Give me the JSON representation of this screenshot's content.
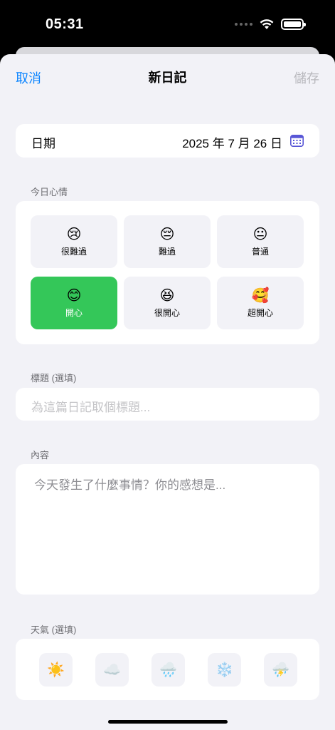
{
  "status_bar": {
    "time": "05:31"
  },
  "nav": {
    "cancel": "取消",
    "title": "新日記",
    "save": "儲存"
  },
  "date": {
    "label": "日期",
    "value": "2025 年 7 月 26 日"
  },
  "mood": {
    "section_label": "今日心情",
    "options": [
      {
        "emoji": "😢",
        "label": "很難過"
      },
      {
        "emoji": "😔",
        "label": "難過"
      },
      {
        "emoji": "😐",
        "label": "普通"
      },
      {
        "emoji": "😊",
        "label": "開心"
      },
      {
        "emoji": "😆",
        "label": "很開心"
      },
      {
        "emoji": "🥰",
        "label": "超開心"
      }
    ],
    "selected": "開心",
    "selected_color": "#34c759"
  },
  "title_field": {
    "section_label": "標題 (選填)",
    "placeholder": "為這篇日記取個標題..."
  },
  "content_field": {
    "section_label": "內容",
    "placeholder": "今天發生了什麼事情？你的感想是..."
  },
  "weather": {
    "section_label": "天氣 (選填)",
    "options": [
      "☀️",
      "☁️",
      "🌧️",
      "❄️",
      "⛈️"
    ]
  },
  "accent_color": "#0a84ff"
}
